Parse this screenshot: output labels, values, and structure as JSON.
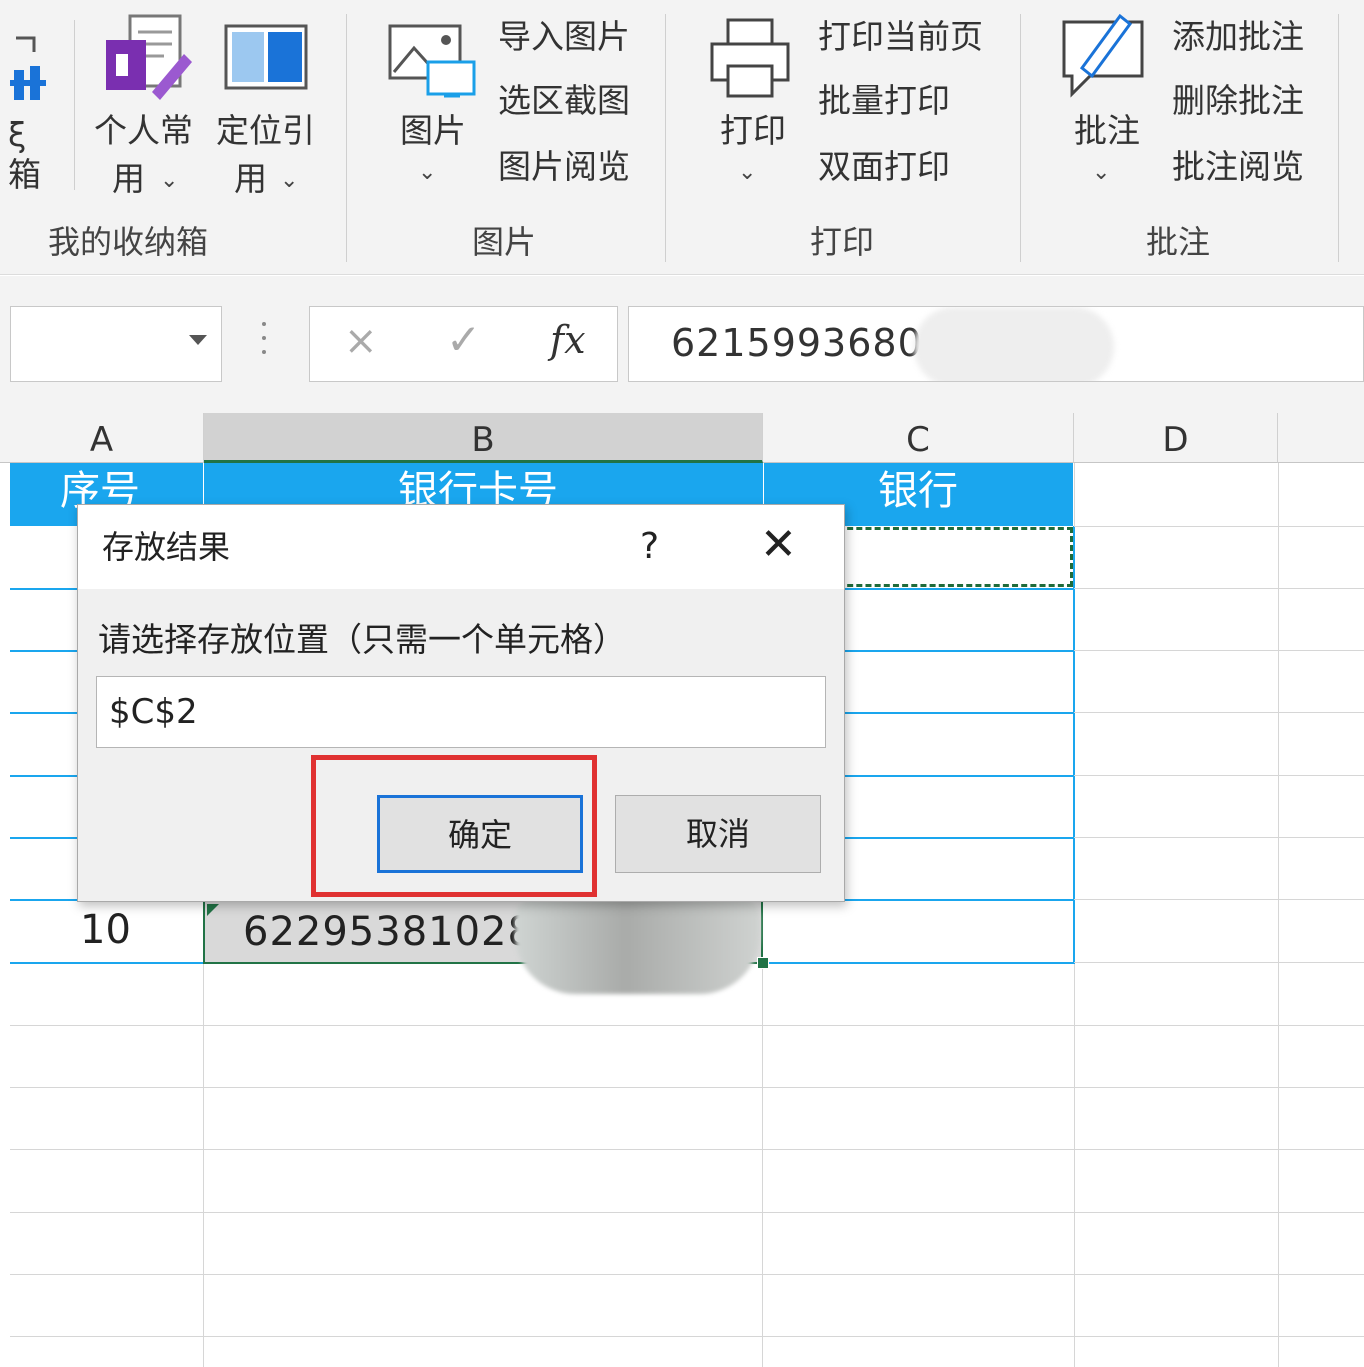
{
  "ribbon": {
    "storage_group": {
      "partial_label_top": "ξ",
      "partial_label_bottom": "箱",
      "personal_label_1": "个人常",
      "personal_label_2": "用",
      "locate_label_1": "定位引",
      "locate_label_2": "用",
      "group_label": "我的收纳箱"
    },
    "picture_group": {
      "button_label": "图片",
      "import": "导入图片",
      "screenshot": "选区截图",
      "viewer": "图片阅览",
      "group_label": "图片"
    },
    "print_group": {
      "button_label": "打印",
      "current_page": "打印当前页",
      "batch": "批量打印",
      "duplex": "双面打印",
      "group_label": "打印"
    },
    "comment_group": {
      "button_label": "批注",
      "add": "添加批注",
      "delete": "删除批注",
      "viewer": "批注阅览",
      "group_label": "批注"
    }
  },
  "formula_bar": {
    "cancel_symbol": "×",
    "confirm_symbol": "✓",
    "fx_symbol": "fx",
    "value": "62159936800"
  },
  "grid": {
    "columns": [
      "A",
      "B",
      "C",
      "D"
    ],
    "selected_column": "B",
    "header_row": {
      "a": "序号",
      "b": "银行卡号",
      "c": "银行"
    },
    "row10": {
      "a": "10",
      "b": "62295381028"
    }
  },
  "dialog": {
    "title": "存放结果",
    "help": "?",
    "close": "✕",
    "prompt": "请选择存放位置（只需一个单元格）",
    "input_value": "$C$2",
    "ok_label": "确定",
    "cancel_label": "取消"
  },
  "colors": {
    "header_blue": "#1aa6ee",
    "excel_green": "#217346",
    "highlight_red": "#e03131",
    "focus_blue": "#1a73d8"
  }
}
